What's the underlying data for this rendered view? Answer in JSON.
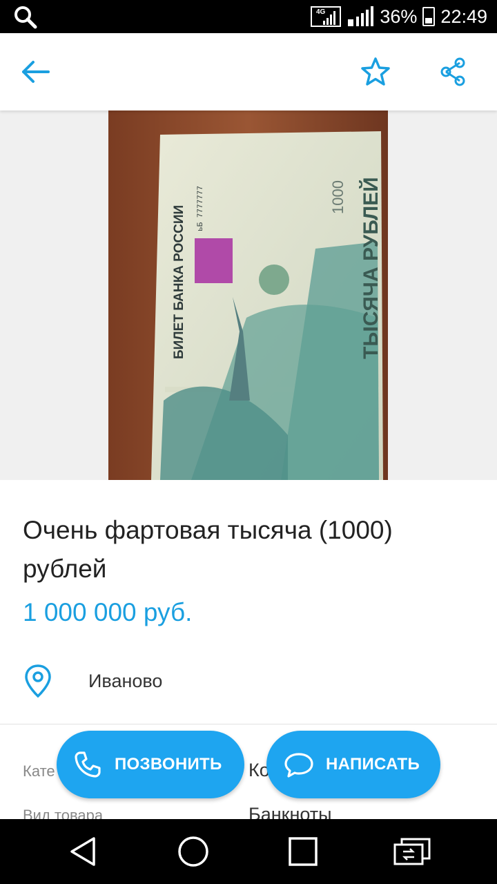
{
  "status_bar": {
    "network_label": "4G",
    "battery": "36%",
    "time": "22:49"
  },
  "app_bar": {
    "back_icon": "arrow-left-icon",
    "favorite_icon": "star-outline-icon",
    "share_icon": "share-icon",
    "accent_color": "#1a9fe0"
  },
  "photo": {
    "banknote_text": "БИЛЕТ БАНКА РОССИИ",
    "serial": "ьБ 7777777",
    "denomination_text": "ТЫСЯЧА РУБЛЕЙ",
    "denomination_number": "1000"
  },
  "listing": {
    "title": "Очень фартовая тысяча (1000) рублей",
    "price": "1 000 000 руб.",
    "location": "Иваново"
  },
  "params": [
    {
      "label": "Кате",
      "value": "Ко"
    },
    {
      "label": "Вид товара",
      "value": "Банкноты"
    }
  ],
  "hidden_suffix": "е",
  "actions": {
    "call_label": "ПОЗВОНИТЬ",
    "message_label": "НАПИСАТЬ",
    "color": "#1ea5f0"
  },
  "nav_bar": {
    "back_icon": "triangle-back-icon",
    "home_icon": "circle-home-icon",
    "recents_icon": "square-recents-icon",
    "switch_icon": "switch-apps-icon"
  }
}
